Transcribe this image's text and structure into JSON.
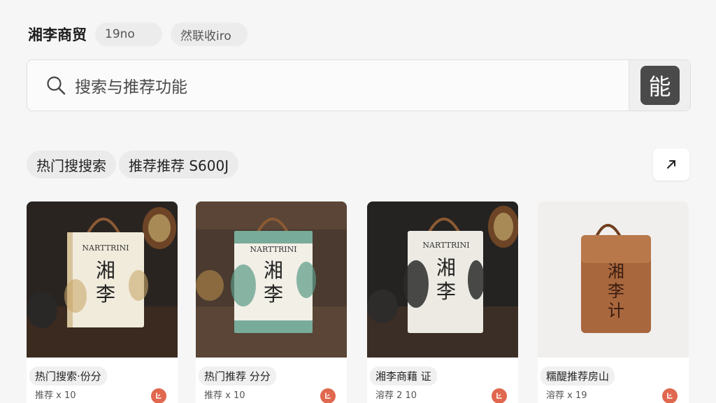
{
  "header": {
    "brand": "湘李商贸",
    "chip_1": "19no",
    "chip_2": "然联收iro"
  },
  "search": {
    "placeholder": "搜索与推荐功能",
    "button_label": "能"
  },
  "tags": [
    "热门搜搜索",
    "推荐推荐 S600J"
  ],
  "products": [
    {
      "title": "热门搜索·份分",
      "meta": "推荐 x 10",
      "bag_brand": "NARTTRINI",
      "bag_chars": [
        "湘",
        "李"
      ],
      "bg": "#2a2421",
      "bag_color": "#f1ebdc",
      "accent": "#c9a86a"
    },
    {
      "title": "热门推荐 分分",
      "meta": "推荐 x 10",
      "bag_brand": "NARTTRINI",
      "bag_chars": [
        "湘",
        "李"
      ],
      "bg": "#4a3a30",
      "bag_color": "#f1efe6",
      "accent": "#5a9a86"
    },
    {
      "title": "湘李商藉 证",
      "meta": "溶荐 2 10",
      "bag_brand": "NARTTRINI",
      "bag_chars": [
        "湘",
        "李"
      ],
      "bg": "#252321",
      "bag_color": "#eceae2",
      "accent": "#2c2c2c"
    },
    {
      "title": "糯醍推荐房山",
      "meta": "溶荐 x 19",
      "bag_brand": "",
      "bag_chars": [
        "湘",
        "李",
        "计"
      ],
      "bg": "#f0efed",
      "bag_color": "#a9673e",
      "accent": "#3a1d10"
    }
  ],
  "icons": {
    "search": "magnifier-icon",
    "expand": "arrow-up-right-icon",
    "cart": "cart-icon"
  },
  "colors": {
    "background": "#f6f6f6",
    "cart_accent": "#e0684e",
    "button_dark": "#4a4a4a"
  }
}
